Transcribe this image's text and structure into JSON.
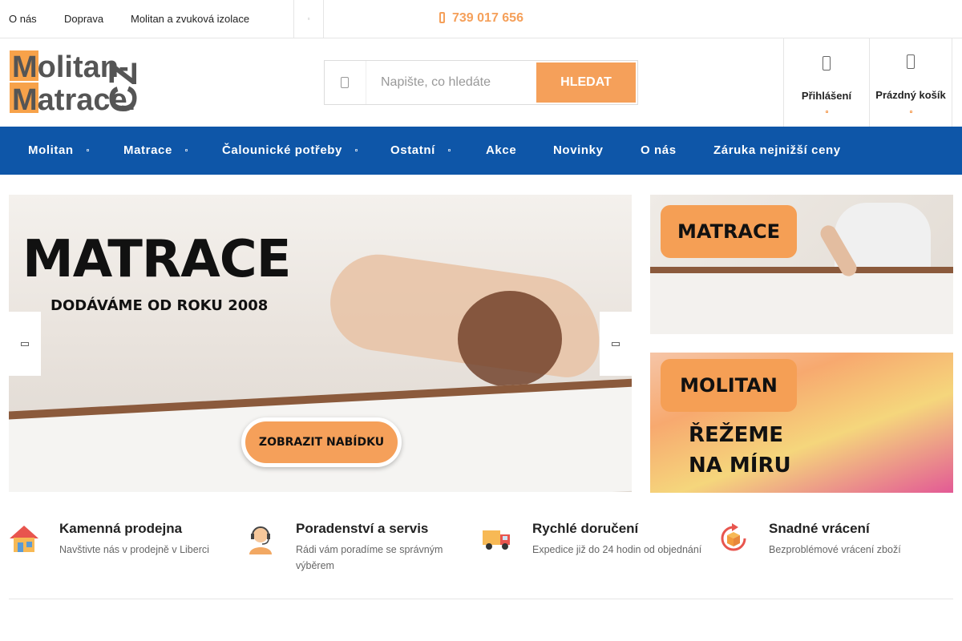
{
  "topbar": {
    "links": [
      "O nás",
      "Doprava",
      "Molitan a zvuková izolace"
    ],
    "phone": "739 017 656"
  },
  "logo": {
    "line1": "Molitan-",
    "line2": "Matrace.",
    "tld": "CZ"
  },
  "search": {
    "placeholder": "Napište, co hledáte",
    "button": "HLEDAT"
  },
  "account": {
    "login_label": "Přihlášení",
    "cart_label": "Prázdný košík"
  },
  "nav": {
    "items": [
      {
        "label": "Molitan"
      },
      {
        "label": "Matrace"
      },
      {
        "label": "Čalounické potřeby"
      },
      {
        "label": "Ostatní"
      },
      {
        "label": "Akce"
      },
      {
        "label": "Novinky"
      },
      {
        "label": "O nás"
      },
      {
        "label": "Záruka nejnižší ceny"
      }
    ]
  },
  "slider": {
    "heading": "MATRACE",
    "subheading": "DODÁVÁME OD ROKU 2008",
    "cta": "ZOBRAZIT NABÍDKU"
  },
  "side_banners": [
    {
      "badge": "MATRACE"
    },
    {
      "badge": "MOLITAN",
      "line1": "ŘEŽEME",
      "line2": "NA MÍRU"
    }
  ],
  "features": [
    {
      "icon": "store-icon",
      "title": "Kamenná prodejna",
      "desc": "Navštivte nás v prodejně v Liberci"
    },
    {
      "icon": "support-icon",
      "title": "Poradenství a servis",
      "desc": "Rádi vám poradíme se správným výběrem"
    },
    {
      "icon": "delivery-truck-icon",
      "title": "Rychlé doručení",
      "desc": "Expedice již do 24 hodin od objednání"
    },
    {
      "icon": "return-icon",
      "title": "Snadné vrácení",
      "desc": "Bezproblémové vrácení zboží"
    }
  ],
  "colors": {
    "accent": "#f5a05a",
    "nav": "#0e56a8",
    "logo_orange": "#f7a24a",
    "logo_dark": "#555555"
  }
}
